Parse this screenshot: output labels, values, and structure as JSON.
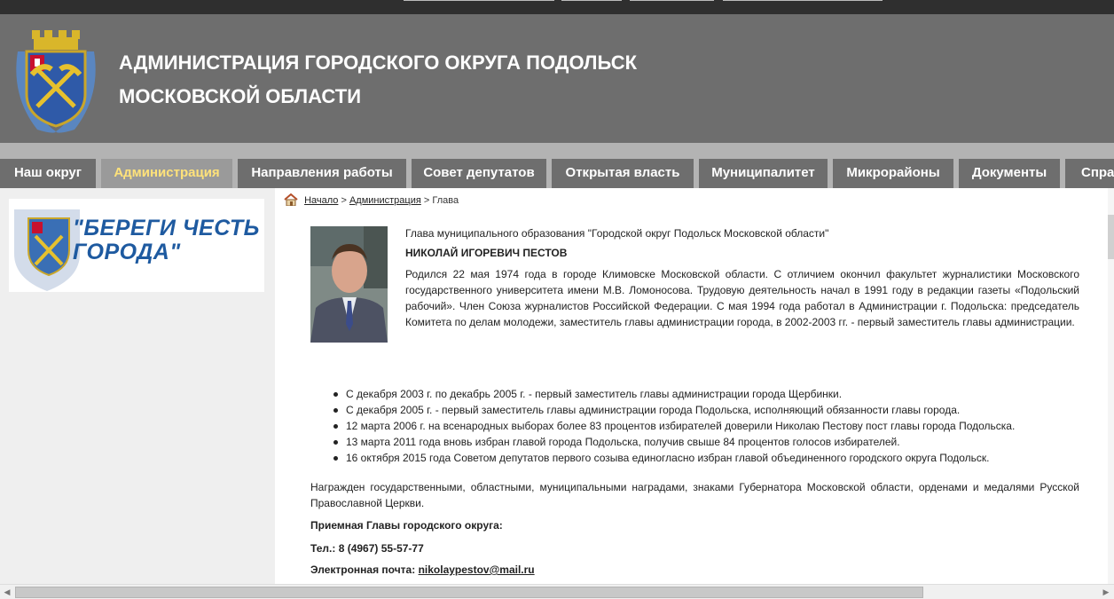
{
  "header": {
    "title_line1": "АДМИНИСТРАЦИЯ ГОРОДСКОГО ОКРУГА ПОДОЛЬСК",
    "title_line2": "МОСКОВСКОЙ ОБЛАСТИ"
  },
  "nav": {
    "items": [
      {
        "label": "Наш округ"
      },
      {
        "label": "Администрация"
      },
      {
        "label": "Направления работы"
      },
      {
        "label": "Совет депутатов"
      },
      {
        "label": "Открытая власть"
      },
      {
        "label": "Муниципалитет"
      },
      {
        "label": "Микрорайоны"
      },
      {
        "label": "Документы"
      },
      {
        "label": "Справ"
      }
    ],
    "active": "Администрация"
  },
  "sidebar": {
    "banner_line1": "\"БЕРЕГИ ЧЕСТЬ",
    "banner_line2": "ГОРОДА\""
  },
  "breadcrumb": {
    "home": "Начало",
    "sep": ">",
    "section": "Администрация",
    "current": "Глава"
  },
  "profile": {
    "post": "Глава муниципального образования \"Городской округ Подольск Московской области\"",
    "name": "НИКОЛАЙ ИГОРЕВИЧ ПЕСТОВ",
    "bio": "Родился 22 мая 1974 года в городе Климовске Московской области. С отличием окончил факультет журналистики Московского государственного университета имени М.В. Ломоносова. Трудовую деятельность начал в 1991 году в редакции газеты «Подольский рабочий». Член Союза журналистов Российской Федерации. С мая 1994 года работал в Администрации г. Подольска: председатель Комитета по делам молодежи, заместитель главы администрации города, в 2002-2003 гг. - первый заместитель главы администрации.",
    "career": [
      "С декабря 2003 г. по декабрь 2005 г. - первый заместитель главы администрации города Щербинки.",
      "С декабря 2005 г. - первый заместитель главы администрации города Подольска, исполняющий обязанности главы города.",
      "12 марта 2006 г. на всенародных выборах более 83 процентов избирателей доверили Николаю Пестову пост главы города Подольска.",
      "13 марта 2011 года вновь избран главой города Подольска, получив свыше 84 процентов голосов избирателей.",
      "16 октября 2015 года Советом депутатов первого созыва единогласно избран главой объединенного городского округа Подольск."
    ],
    "awards": "Награжден государственными, областными, муниципальными наградами, знаками Губернатора Московской области, орденами и медалями Русской Православной Церкви."
  },
  "contact": {
    "reception": "Приемная Главы городского округа:",
    "phone": "Тел.: 8 (4967) 55-57-77",
    "email_label": "Электронная почта:",
    "email": "nikolaypestov@mail.ru"
  },
  "colors": {
    "header_bg": "#6e6e6e",
    "nav_bg": "#b3b3b3",
    "active_tab_text": "#ffe27a",
    "banner_text": "#1e5aa0"
  }
}
